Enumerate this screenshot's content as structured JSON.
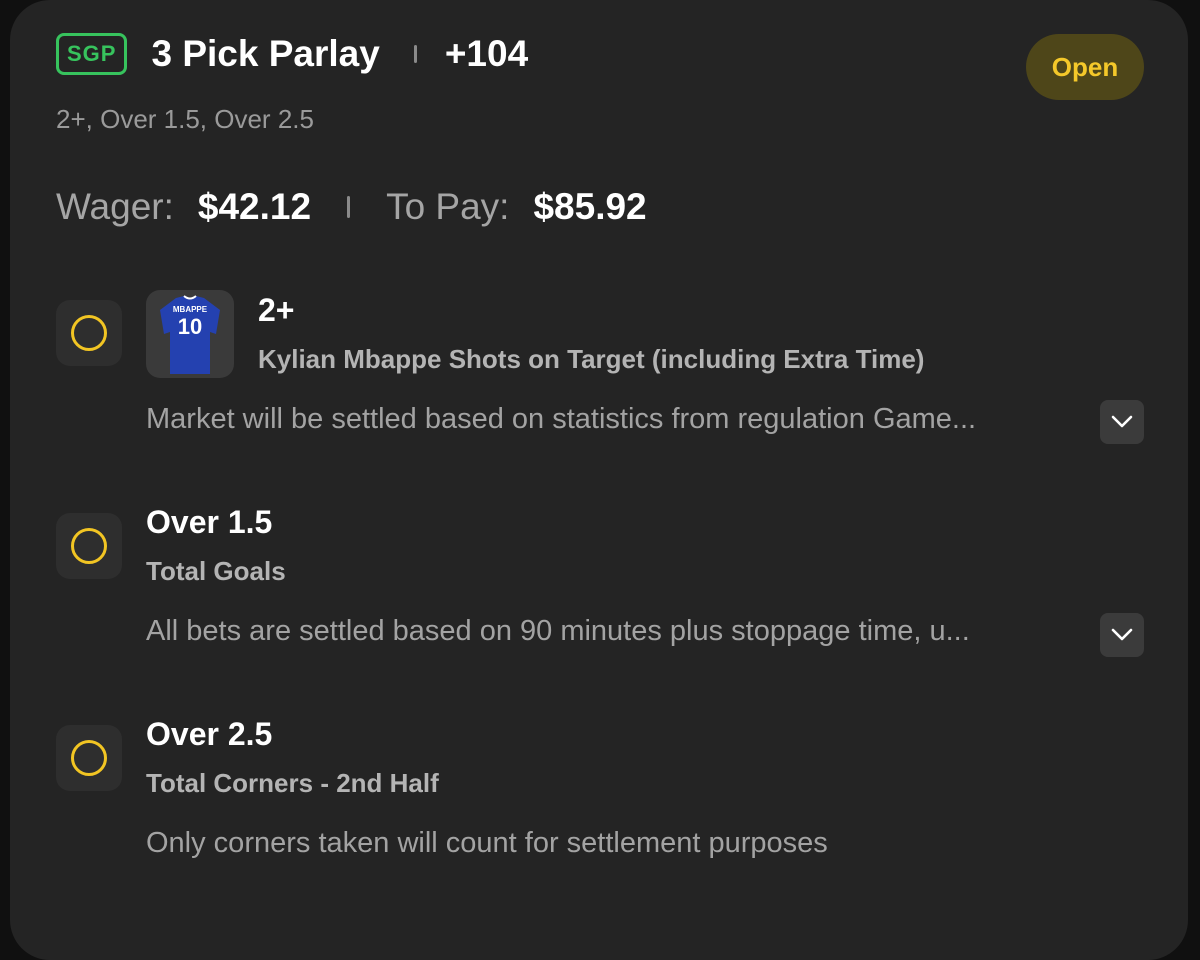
{
  "header": {
    "badge": "SGP",
    "title": "3 Pick Parlay",
    "odds": "+104",
    "status": "Open"
  },
  "subtitle": "2+, Over 1.5, Over 2.5",
  "wager": {
    "label": "Wager:",
    "value": "$42.12"
  },
  "payout": {
    "label": "To Pay:",
    "value": "$85.92"
  },
  "legs": [
    {
      "value": "2+",
      "market": "Kylian Mbappe Shots on Target (including Extra Time)",
      "description": "Market will be settled based on statistics from regulation Game...",
      "jersey": {
        "name": "MBAPPE",
        "number": "10",
        "color": "#2441b0"
      }
    },
    {
      "value": "Over 1.5",
      "market": "Total Goals",
      "description": "All bets are settled based on 90 minutes plus stoppage time, u..."
    },
    {
      "value": "Over 2.5",
      "market": "Total Corners - 2nd Half",
      "description": "Only corners taken will count for settlement purposes"
    }
  ],
  "colors": {
    "accent_green": "#37c35d",
    "status_yellow": "#f4c82a",
    "card_bg": "#242424"
  },
  "icons": {
    "leg_status": "empty-circle-icon",
    "expand": "chevron-down-icon"
  }
}
